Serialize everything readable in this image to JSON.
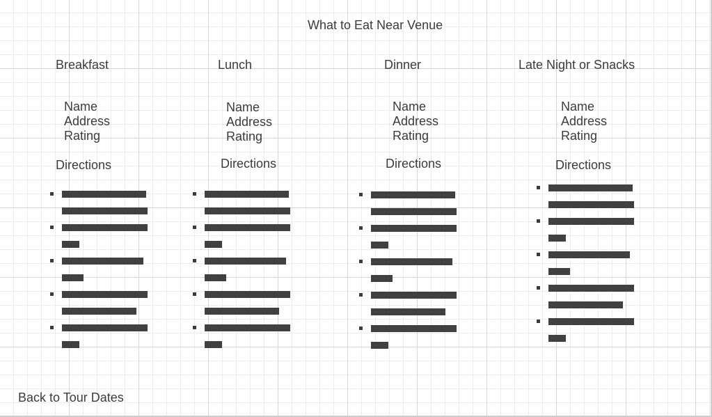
{
  "page": {
    "title": "What to Eat Near Venue",
    "back_link": "Back to Tour Dates"
  },
  "columns": [
    {
      "heading": "Breakfast",
      "fields": [
        "Name",
        "Address",
        "Rating"
      ],
      "directions_label": "Directions",
      "steps": [
        {
          "bullet": true,
          "fill": 0.98
        },
        {
          "bullet": false,
          "fill": 1.0
        },
        {
          "bullet": true,
          "fill": 1.0
        },
        {
          "bullet": false,
          "fill": 0.2
        },
        {
          "bullet": true,
          "fill": 0.95
        },
        {
          "bullet": false,
          "fill": 0.25
        },
        {
          "bullet": true,
          "fill": 1.0
        },
        {
          "bullet": false,
          "fill": 0.87
        },
        {
          "bullet": true,
          "fill": 1.0
        },
        {
          "bullet": false,
          "fill": 0.2
        }
      ]
    },
    {
      "heading": "Lunch",
      "fields": [
        "Name",
        "Address",
        "Rating"
      ],
      "directions_label": "Directions",
      "steps": [
        {
          "bullet": true,
          "fill": 0.98
        },
        {
          "bullet": false,
          "fill": 1.0
        },
        {
          "bullet": true,
          "fill": 1.0
        },
        {
          "bullet": false,
          "fill": 0.2
        },
        {
          "bullet": true,
          "fill": 0.95
        },
        {
          "bullet": false,
          "fill": 0.25
        },
        {
          "bullet": true,
          "fill": 1.0
        },
        {
          "bullet": false,
          "fill": 0.87
        },
        {
          "bullet": true,
          "fill": 1.0
        },
        {
          "bullet": false,
          "fill": 0.2
        }
      ]
    },
    {
      "heading": "Dinner",
      "fields": [
        "Name",
        "Address",
        "Rating"
      ],
      "directions_label": "Directions",
      "steps": [
        {
          "bullet": true,
          "fill": 0.98
        },
        {
          "bullet": false,
          "fill": 1.0
        },
        {
          "bullet": true,
          "fill": 1.0
        },
        {
          "bullet": false,
          "fill": 0.2
        },
        {
          "bullet": true,
          "fill": 0.95
        },
        {
          "bullet": false,
          "fill": 0.25
        },
        {
          "bullet": true,
          "fill": 1.0
        },
        {
          "bullet": false,
          "fill": 0.87
        },
        {
          "bullet": true,
          "fill": 1.0
        },
        {
          "bullet": false,
          "fill": 0.2
        }
      ]
    },
    {
      "heading": "Late Night or Snacks",
      "fields": [
        "Name",
        "Address",
        "Rating"
      ],
      "directions_label": "Directions",
      "steps": [
        {
          "bullet": true,
          "fill": 0.98
        },
        {
          "bullet": false,
          "fill": 1.0
        },
        {
          "bullet": true,
          "fill": 1.0
        },
        {
          "bullet": false,
          "fill": 0.2
        },
        {
          "bullet": true,
          "fill": 0.95
        },
        {
          "bullet": false,
          "fill": 0.25
        },
        {
          "bullet": true,
          "fill": 1.0
        },
        {
          "bullet": false,
          "fill": 0.87
        },
        {
          "bullet": true,
          "fill": 1.0
        },
        {
          "bullet": false,
          "fill": 0.2
        }
      ]
    }
  ],
  "colors": {
    "text": "#3c3c3c",
    "placeholder_bar": "#404040",
    "grid_major": "#d6d6d6",
    "grid_minor": "#ececec"
  }
}
